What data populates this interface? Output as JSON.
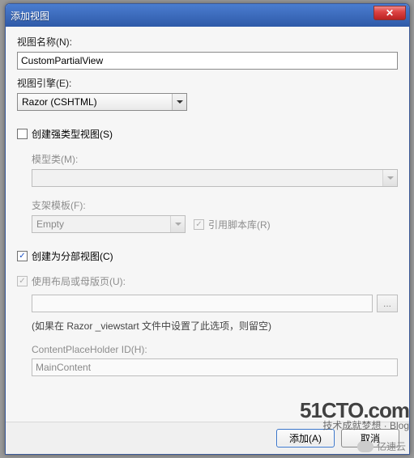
{
  "window": {
    "title": "添加视图"
  },
  "labels": {
    "viewName": "视图名称(N):",
    "viewEngine": "视图引擎(E):",
    "modelClass": "模型类(M):",
    "scaffoldTemplate": "支架模板(F):",
    "contentPlaceholder": "ContentPlaceHolder ID(H):"
  },
  "fields": {
    "viewName": "CustomPartialView",
    "viewEngine": "Razor (CSHTML)",
    "modelClass": "",
    "scaffoldTemplate": "Empty",
    "layoutPath": "",
    "contentPlaceholder": "MainContent"
  },
  "checkboxes": {
    "strongType": {
      "label": "创建强类型视图(S)",
      "checked": false
    },
    "refScripts": {
      "label": "引用脚本库(R)",
      "checked": true
    },
    "partial": {
      "label": "创建为分部视图(C)",
      "checked": true
    },
    "useLayout": {
      "label": "使用布局或母版页(U):",
      "checked": true
    }
  },
  "hint": "(如果在 Razor _viewstart 文件中设置了此选项，则留空)",
  "buttons": {
    "browse": "...",
    "add": "添加(A)",
    "cancel": "取消"
  },
  "watermark": {
    "main": "51CTO.com",
    "sub": "技术成就梦想 · Blog",
    "yisu": "亿速云"
  }
}
